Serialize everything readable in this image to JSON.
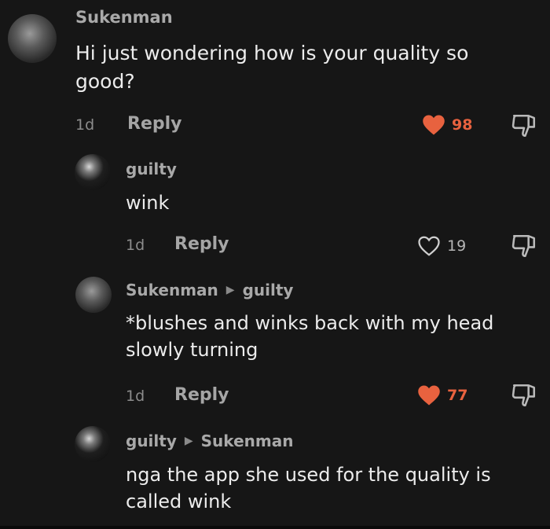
{
  "comments": [
    {
      "username": "Sukenman",
      "text": "Hi just wondering how is your quality so good?",
      "time": "1d",
      "reply_label": "Reply",
      "likes": "98",
      "liked": true
    },
    {
      "username": "guilty",
      "text": "wink",
      "time": "1d",
      "reply_label": "Reply",
      "likes": "19",
      "liked": false
    },
    {
      "username": "Sukenman",
      "reply_to": "guilty",
      "text": "*blushes and winks back with my head slowly turning",
      "time": "1d",
      "reply_label": "Reply",
      "likes": "77",
      "liked": true
    },
    {
      "username": "guilty",
      "reply_to": "Sukenman",
      "text": "nga the app she used for the quality is called wink"
    }
  ],
  "colors": {
    "background": "#161616",
    "like_active": "#e8623f",
    "username": "#a9a9a9"
  },
  "icons": {
    "like": "heart-icon",
    "dislike": "thumbs-down-icon",
    "reply_arrow": "triangle-right-icon"
  }
}
